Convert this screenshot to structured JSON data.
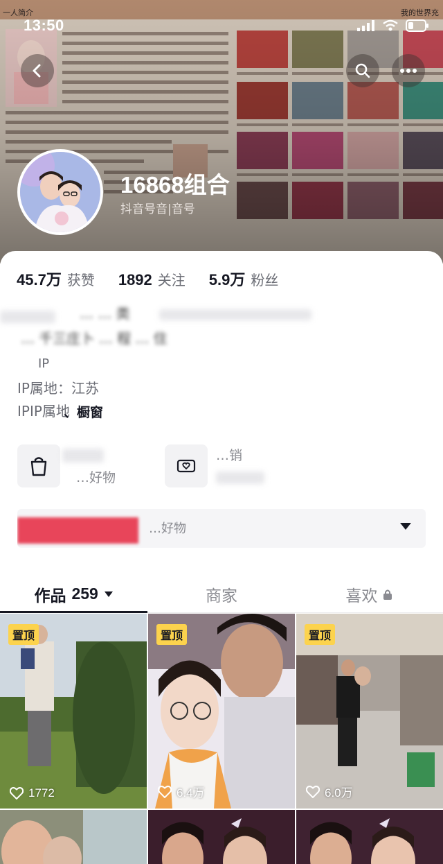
{
  "banner": {
    "top_left_text": "一人简介",
    "top_right_text": "我的世界充",
    "time": "13:50"
  },
  "profile": {
    "nickname": "16868组合",
    "douyin_id": "抖音号音|音号"
  },
  "stats": [
    {
      "value": "45.7万",
      "label": "获赞"
    },
    {
      "value": "1892",
      "label": "关注"
    },
    {
      "value": "5.9万",
      "label": "粉丝"
    }
  ],
  "bio": {
    "line1": "… … 类",
    "line2": "… 千三庄卜 … 程 … 住",
    "ip_short": "IP",
    "ip_location": "IP属地：江苏",
    "ip_repeat": "IPIP属地",
    "window_label": "、橱窗"
  },
  "shop": {
    "tile1_text": "…好物",
    "tile2_text": "…销",
    "strip_text": "…好物"
  },
  "tabs": [
    {
      "label": "作品",
      "count": "259"
    },
    {
      "label": "商家"
    },
    {
      "label": "喜欢"
    }
  ],
  "videos": [
    {
      "pinned": "置顶",
      "likes": "1772"
    },
    {
      "pinned": "置顶",
      "likes": "6.4万"
    },
    {
      "pinned": "置顶",
      "likes": "6.0万"
    }
  ],
  "colors": {
    "accent_pin": "#fcd34d",
    "strip_red": "#e8455a",
    "text_primary": "#161823",
    "text_secondary": "#6b6d75"
  }
}
